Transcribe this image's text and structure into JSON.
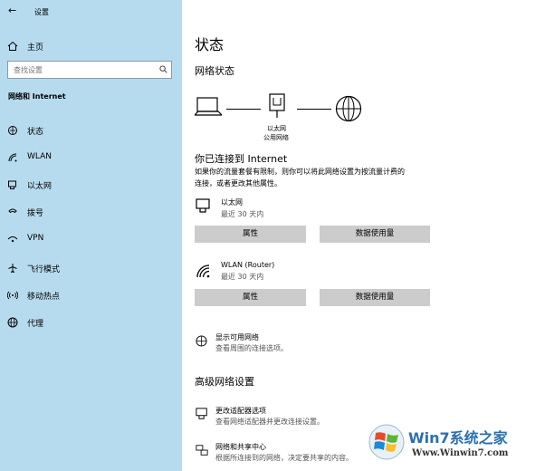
{
  "window": {
    "title": "设置"
  },
  "sidebar": {
    "home_label": "主页",
    "search_placeholder": "查找设置",
    "section_title": "网络和 Internet",
    "items": [
      {
        "label": "状态",
        "icon": "home-network-icon"
      },
      {
        "label": "WLAN",
        "icon": "wifi-icon"
      },
      {
        "label": "以太网",
        "icon": "ethernet-icon"
      },
      {
        "label": "拨号",
        "icon": "dialup-icon"
      },
      {
        "label": "VPN",
        "icon": "vpn-icon"
      },
      {
        "label": "飞行模式",
        "icon": "airplane-icon"
      },
      {
        "label": "移动热点",
        "icon": "hotspot-icon"
      },
      {
        "label": "代理",
        "icon": "globe-icon"
      }
    ]
  },
  "main": {
    "page_title": "状态",
    "network_status_heading": "网络状态",
    "diagram": {
      "adapter_name": "以太网",
      "network_type": "公用网络"
    },
    "connected_heading": "你已连接到 Internet",
    "connected_desc_line1": "如果你的流量套餐有限制，则你可以将此网络设置为按流量计费的",
    "connected_desc_line2": "连接，或者更改其他属性。",
    "connections": [
      {
        "name": "以太网",
        "usage": "最近 30 天内",
        "properties_label": "属性",
        "data_usage_label": "数据使用量"
      },
      {
        "name": "WLAN (Router)",
        "usage": "最近 30 天内",
        "properties_label": "属性",
        "data_usage_label": "数据使用量"
      }
    ],
    "show_networks": {
      "title": "显示可用网络",
      "desc": "查看周围的连接选项。"
    },
    "advanced_heading": "高级网络设置",
    "adapter_options": {
      "title": "更改适配器选项",
      "desc": "查看网络适配器并更改连接设置。"
    },
    "sharing_center": {
      "title": "网络和共享中心",
      "desc": "根据所连接到的网络，决定要共享的内容。"
    }
  },
  "watermark": {
    "brand": "Win7系统之家",
    "url": "Www.Winwin7.com"
  }
}
